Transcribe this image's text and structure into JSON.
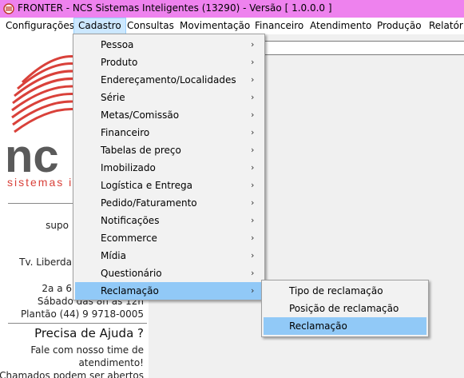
{
  "window": {
    "title": "FRONTER - NCS Sistemas Inteligentes (13290) - Versão [ 1.0.0.0 ]"
  },
  "menubar": {
    "items": [
      {
        "label": "Configurações"
      },
      {
        "label": "Cadastro"
      },
      {
        "label": "Consultas"
      },
      {
        "label": "Movimentação"
      },
      {
        "label": "Financeiro"
      },
      {
        "label": "Atendimento"
      },
      {
        "label": "Produção"
      },
      {
        "label": "Relatório"
      }
    ]
  },
  "cadastro_menu": {
    "items": [
      {
        "label": "Pessoa"
      },
      {
        "label": "Produto"
      },
      {
        "label": "Endereçamento/Localidades"
      },
      {
        "label": "Série"
      },
      {
        "label": "Metas/Comissão"
      },
      {
        "label": "Financeiro"
      },
      {
        "label": "Tabelas de preço"
      },
      {
        "label": "Imobilizado"
      },
      {
        "label": "Logística e Entrega"
      },
      {
        "label": "Pedido/Faturamento"
      },
      {
        "label": "Notificações"
      },
      {
        "label": "Ecommerce"
      },
      {
        "label": "Mídia"
      },
      {
        "label": "Questionário"
      },
      {
        "label": "Reclamação"
      }
    ],
    "arrow": "›"
  },
  "reclamacao_submenu": {
    "items": [
      {
        "label": "Tipo de reclamação"
      },
      {
        "label": "Posição de reclamação"
      },
      {
        "label": "Reclamação"
      }
    ]
  },
  "left_panel": {
    "logo_text": "nc",
    "logo_subtitle": "sistemas in",
    "suporte": "supo",
    "address": "Tv. Liberda",
    "hours": "2a a 6",
    "saturday": "Sábado das 8h às 12h",
    "plantao": "Plantão  (44) 9 9718-0005",
    "help_title": "Precisa de Ajuda ?",
    "help_line1": "Fale com nosso time de",
    "help_line2": "atendimento!",
    "help_line3": "Chamados podem ser abertos"
  },
  "colors": {
    "titlebar": "#ee82ee",
    "menu_highlight": "#91c9f7",
    "logo_red": "#d9413a",
    "logo_gray": "#5a5a5a"
  }
}
